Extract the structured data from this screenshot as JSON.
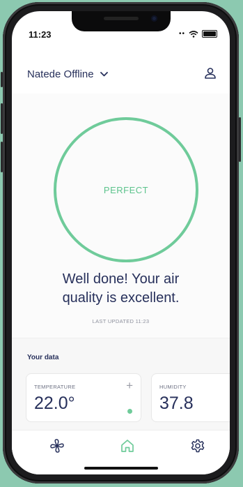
{
  "status_bar": {
    "time": "11:23"
  },
  "header": {
    "device_name": "Natede Offline"
  },
  "air_quality": {
    "status": "PERFECT",
    "headline_line1": "Well done! Your air",
    "headline_line2": "quality is excellent.",
    "last_updated_label": "LAST UPDATED",
    "last_updated_time": "11:23",
    "ring_color": "#6fcb9a"
  },
  "data_section": {
    "title": "Your data",
    "cards": [
      {
        "label": "TEMPERATURE",
        "value": "22.0°",
        "action_icon": "plus-icon"
      },
      {
        "label": "HUMIDITY",
        "value": "37.8"
      }
    ]
  },
  "tabbar": {
    "items": [
      {
        "icon": "fan-icon"
      },
      {
        "icon": "home-icon",
        "active": true
      },
      {
        "icon": "gear-icon"
      }
    ]
  },
  "colors": {
    "accent": "#6fcb9a",
    "text_primary": "#27305b",
    "text_muted": "#8c8f9c"
  }
}
